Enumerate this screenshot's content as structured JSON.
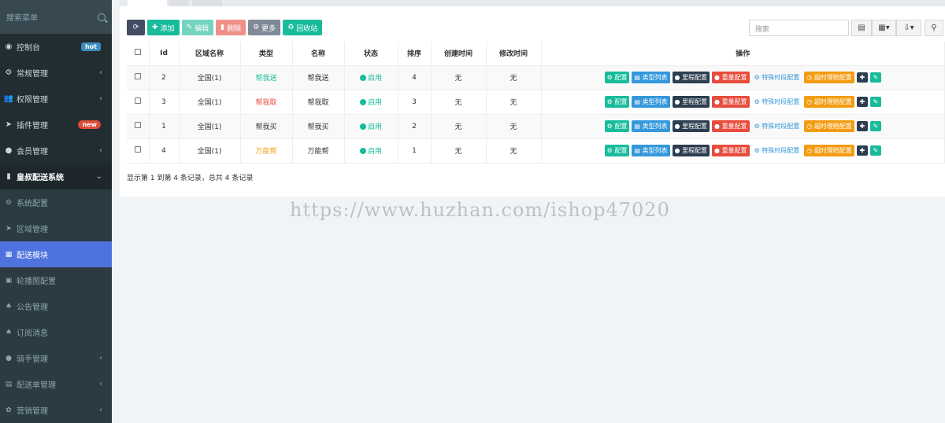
{
  "sidebar": {
    "search_placeholder": "搜索菜单",
    "items": [
      {
        "icon": "dashboard-icon",
        "glyph": "◉",
        "label": "控制台",
        "badge": "hot"
      },
      {
        "icon": "cogs-icon",
        "glyph": "⚙",
        "label": "常规管理",
        "chevron": "‹"
      },
      {
        "icon": "group-icon",
        "glyph": "👥",
        "label": "权限管理",
        "chevron": "‹"
      },
      {
        "icon": "rocket-icon",
        "glyph": "➤",
        "label": "插件管理",
        "badge": "new"
      },
      {
        "icon": "user-circle-icon",
        "glyph": "●",
        "label": "会员管理",
        "chevron": "‹"
      },
      {
        "icon": "book-icon",
        "glyph": "▮",
        "label": "皇叔配送系统",
        "chevron": "⌄"
      }
    ],
    "subitems": [
      {
        "icon": "cogs-icon",
        "glyph": "⚙",
        "label": "系统配置"
      },
      {
        "icon": "location-arrow-icon",
        "glyph": "➤",
        "label": "区域管理"
      },
      {
        "icon": "grid-icon",
        "glyph": "▦",
        "label": "配送模块"
      },
      {
        "icon": "image-icon",
        "glyph": "▣",
        "label": "轮播图配置"
      },
      {
        "icon": "bell-icon",
        "glyph": "♠",
        "label": "公告管理"
      },
      {
        "icon": "bell-icon",
        "glyph": "♠",
        "label": "订阅消息"
      },
      {
        "icon": "user-circle-icon",
        "glyph": "●",
        "label": "骑手管理",
        "chevron": "‹"
      },
      {
        "icon": "list-alt-icon",
        "glyph": "▤",
        "label": "配送单管理",
        "chevron": "‹"
      },
      {
        "icon": "gift-icon",
        "glyph": "✿",
        "label": "营销管理",
        "chevron": "‹"
      }
    ]
  },
  "toolbar": {
    "refresh_glyph": "⟳",
    "add": "添加",
    "edit": "编辑",
    "delete": "删除",
    "more": "更多",
    "recycle": "回收站",
    "search_placeholder": "搜索"
  },
  "table": {
    "headers": [
      "Id",
      "区域名称",
      "类型",
      "名称",
      "状态",
      "排序",
      "创建时间",
      "修改时间",
      "操作"
    ],
    "rows": [
      {
        "id": "2",
        "area": "全国(1)",
        "type": "帮我送",
        "type_color": "green",
        "name": "帮我送",
        "status": "启用",
        "sort": "4",
        "created": "无",
        "modified": "无"
      },
      {
        "id": "3",
        "area": "全国(1)",
        "type": "帮我取",
        "type_color": "red",
        "name": "帮我取",
        "status": "启用",
        "sort": "3",
        "created": "无",
        "modified": "无"
      },
      {
        "id": "1",
        "area": "全国(1)",
        "type": "帮我买",
        "type_color": "plain",
        "name": "帮我买",
        "status": "启用",
        "sort": "2",
        "created": "无",
        "modified": "无"
      },
      {
        "id": "4",
        "area": "全国(1)",
        "type": "万能帮",
        "type_color": "orange",
        "name": "万能帮",
        "status": "启用",
        "sort": "1",
        "created": "无",
        "modified": "无"
      }
    ],
    "ops": [
      "配置",
      "类型列表",
      "里程配置",
      "重量配置",
      "特殊时段配置",
      "超时理赔配置"
    ]
  },
  "footer": "显示第 1 到第 4 条记录，总共 4 条记录",
  "watermark": "https://www.huzhan.com/ishop47020",
  "colors": {
    "accent": "#4e73df",
    "green": "#18bc9c",
    "red": "#e74c3c",
    "orange": "#f39c12",
    "sidebar": "#222d32"
  }
}
